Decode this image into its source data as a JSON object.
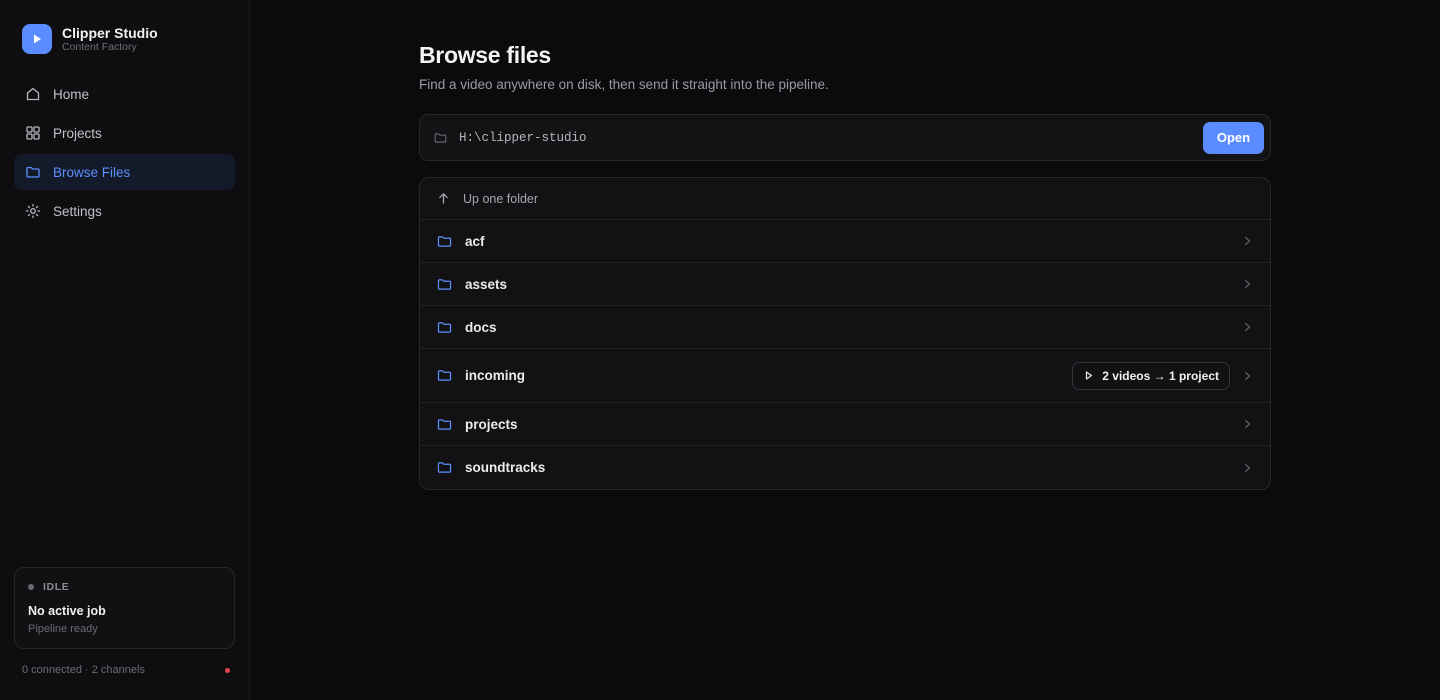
{
  "brand": {
    "title": "Clipper Studio",
    "subtitle": "Content Factory"
  },
  "nav": [
    {
      "label": "Home",
      "icon": "home-icon",
      "active": false
    },
    {
      "label": "Projects",
      "icon": "grid-icon",
      "active": false
    },
    {
      "label": "Browse Files",
      "icon": "folder-icon",
      "active": true
    },
    {
      "label": "Settings",
      "icon": "gear-icon",
      "active": false
    }
  ],
  "status": {
    "label": "IDLE",
    "title": "No active job",
    "subtitle": "Pipeline ready"
  },
  "footer": {
    "text": "0 connected · 2 channels",
    "indicator_color": "#e5484d"
  },
  "page": {
    "title": "Browse files",
    "subtitle": "Find a video anywhere on disk, then send it straight into the pipeline."
  },
  "pathbar": {
    "value": "H:\\clipper-studio",
    "open_label": "Open"
  },
  "file_list": {
    "up_label": "Up one folder",
    "folders": [
      {
        "name": "acf",
        "badge": null
      },
      {
        "name": "assets",
        "badge": null
      },
      {
        "name": "docs",
        "badge": null
      },
      {
        "name": "incoming",
        "badge": "2 videos → 1 project"
      },
      {
        "name": "projects",
        "badge": null
      },
      {
        "name": "soundtracks",
        "badge": null
      }
    ]
  },
  "colors": {
    "accent": "#5b8cff",
    "background": "#0b0b0d",
    "sidebar": "#0e0e10"
  }
}
